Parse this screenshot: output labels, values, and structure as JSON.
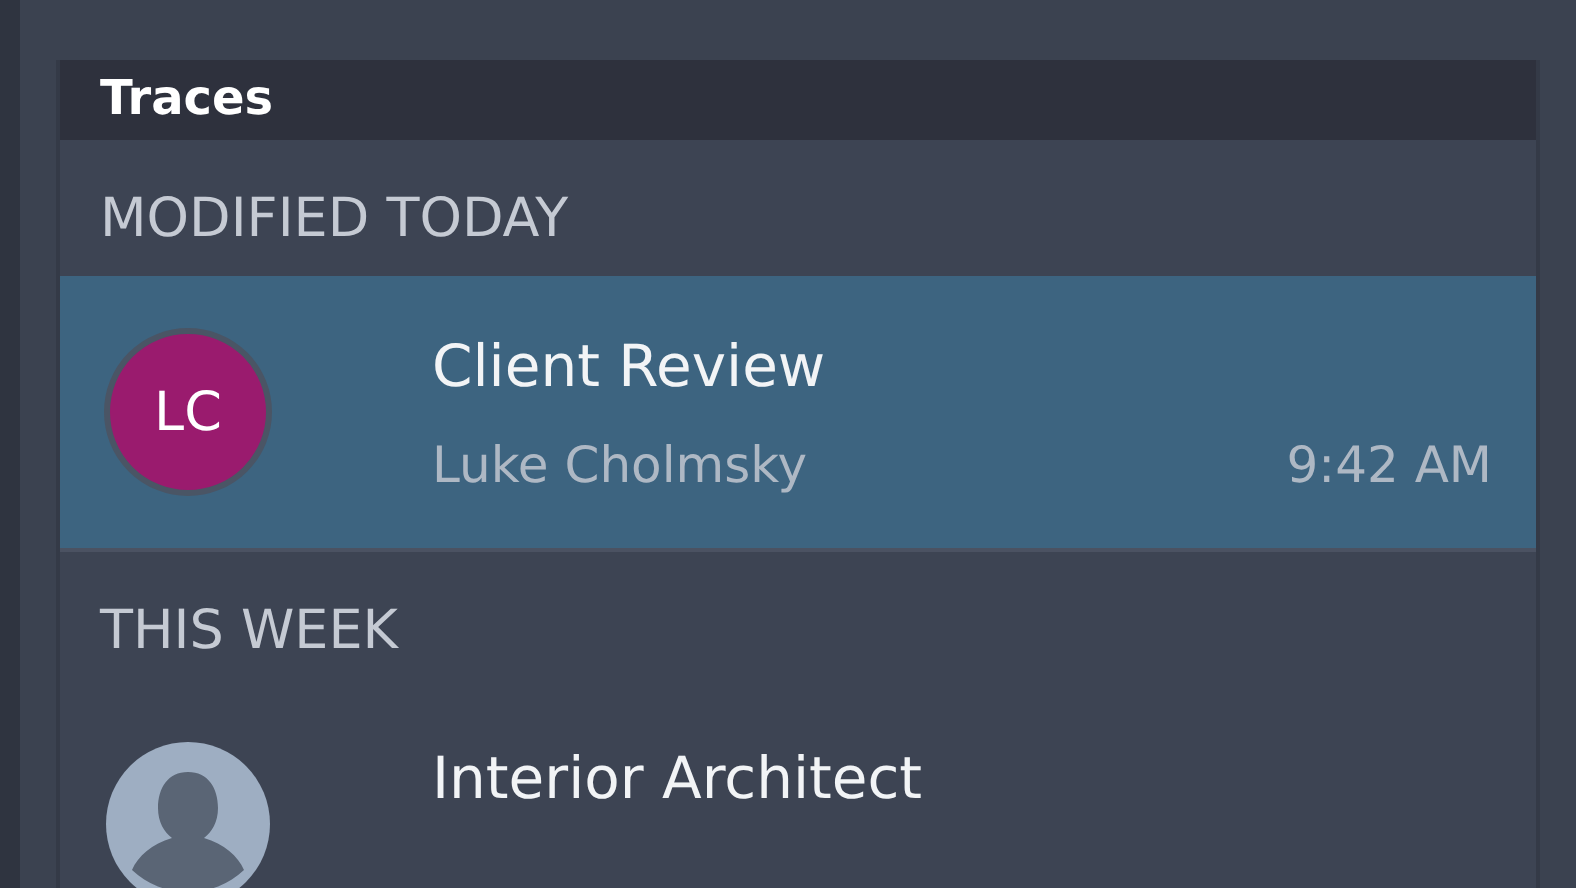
{
  "panel": {
    "title": "Traces"
  },
  "sections": [
    {
      "heading": "MODIFIED TODAY",
      "items": [
        {
          "title": "Client Review",
          "author": "Luke Cholmsky",
          "time": "9:42 AM",
          "selected": true,
          "avatar": {
            "kind": "initials",
            "initials": "LC",
            "color": "#9a1b6e"
          }
        }
      ]
    },
    {
      "heading": "THIS WEEK",
      "items": [
        {
          "title": "Interior Architect",
          "selected": false,
          "avatar": {
            "kind": "silhouette"
          }
        }
      ]
    }
  ]
}
